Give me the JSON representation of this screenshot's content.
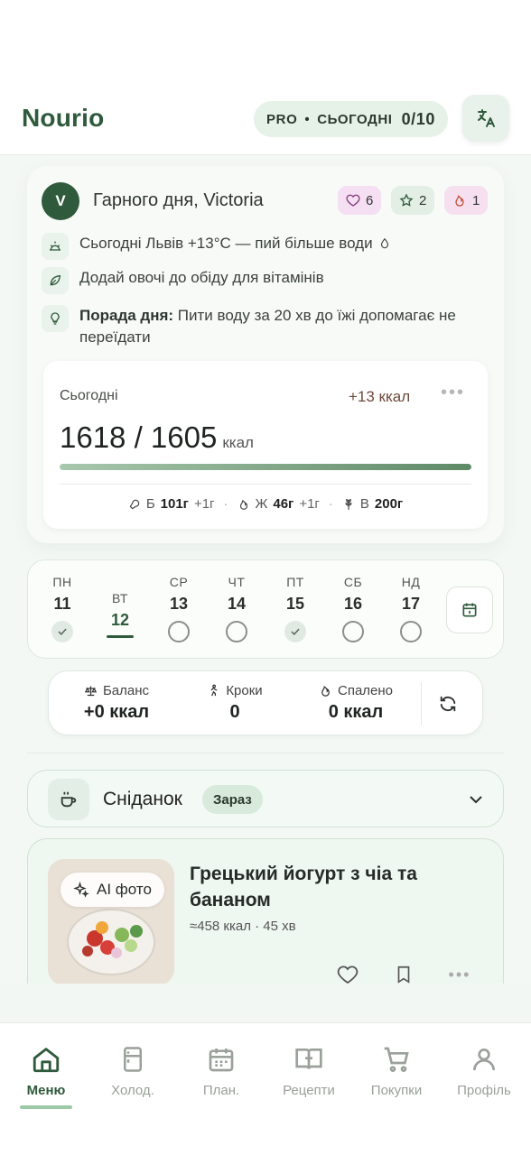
{
  "app": {
    "name": "Nourio"
  },
  "header": {
    "pro_label": "PRO",
    "today_label": "СЬОГОДНІ",
    "today_count": "0/10"
  },
  "greeting": {
    "avatar_letter": "V",
    "text": "Гарного дня, Victoria",
    "likes": "6",
    "stars": "2",
    "fire": "1"
  },
  "tips": {
    "weather": "Сьогодні Львів +13°C — пий більше води",
    "veggies": "Додай овочі до обіду для вітамінів",
    "daily_title": "Порада дня:",
    "daily_text": " Пити воду за 20 хв до їжі допомагає не переїдати"
  },
  "today": {
    "label": "Сьогодні",
    "delta": "+13 ккал",
    "kcal": "1618 / 1605",
    "unit": "ккал",
    "progress": 1.0,
    "protein_label": "Б",
    "protein": "101г",
    "protein_plus": "+1г",
    "fat_label": "Ж",
    "fat": "46г",
    "fat_plus": "+1г",
    "water_label": "В",
    "water": "200г"
  },
  "week": [
    {
      "name": "ПН",
      "num": "11",
      "state": "done"
    },
    {
      "name": "ВТ",
      "num": "12",
      "state": "active"
    },
    {
      "name": "СР",
      "num": "13",
      "state": "empty"
    },
    {
      "name": "ЧТ",
      "num": "14",
      "state": "empty"
    },
    {
      "name": "ПТ",
      "num": "15",
      "state": "done"
    },
    {
      "name": "СБ",
      "num": "16",
      "state": "empty"
    },
    {
      "name": "НД",
      "num": "17",
      "state": "empty"
    }
  ],
  "stats": {
    "balance_label": "Баланс",
    "balance_value": "+0 ккал",
    "steps_label": "Кроки",
    "steps_value": "0",
    "burned_label": "Спалено",
    "burned_value": "0 ккал"
  },
  "meal": {
    "title": "Сніданок",
    "badge": "Зараз"
  },
  "recipe": {
    "ai_label": "AI фото",
    "title": "Грецький йогурт з чіа та бананом",
    "meta": "≈458 ккал · 45 хв"
  },
  "tabs": [
    {
      "label": "Меню",
      "icon": "home-icon"
    },
    {
      "label": "Холод.",
      "icon": "fridge-icon"
    },
    {
      "label": "План.",
      "icon": "calendar-icon"
    },
    {
      "label": "Рецепти",
      "icon": "book-icon"
    },
    {
      "label": "Покупки",
      "icon": "cart-icon"
    },
    {
      "label": "Профіль",
      "icon": "user-icon"
    }
  ],
  "colors": {
    "brand": "#2f5a3c",
    "accent_light": "#e6f1e8"
  }
}
